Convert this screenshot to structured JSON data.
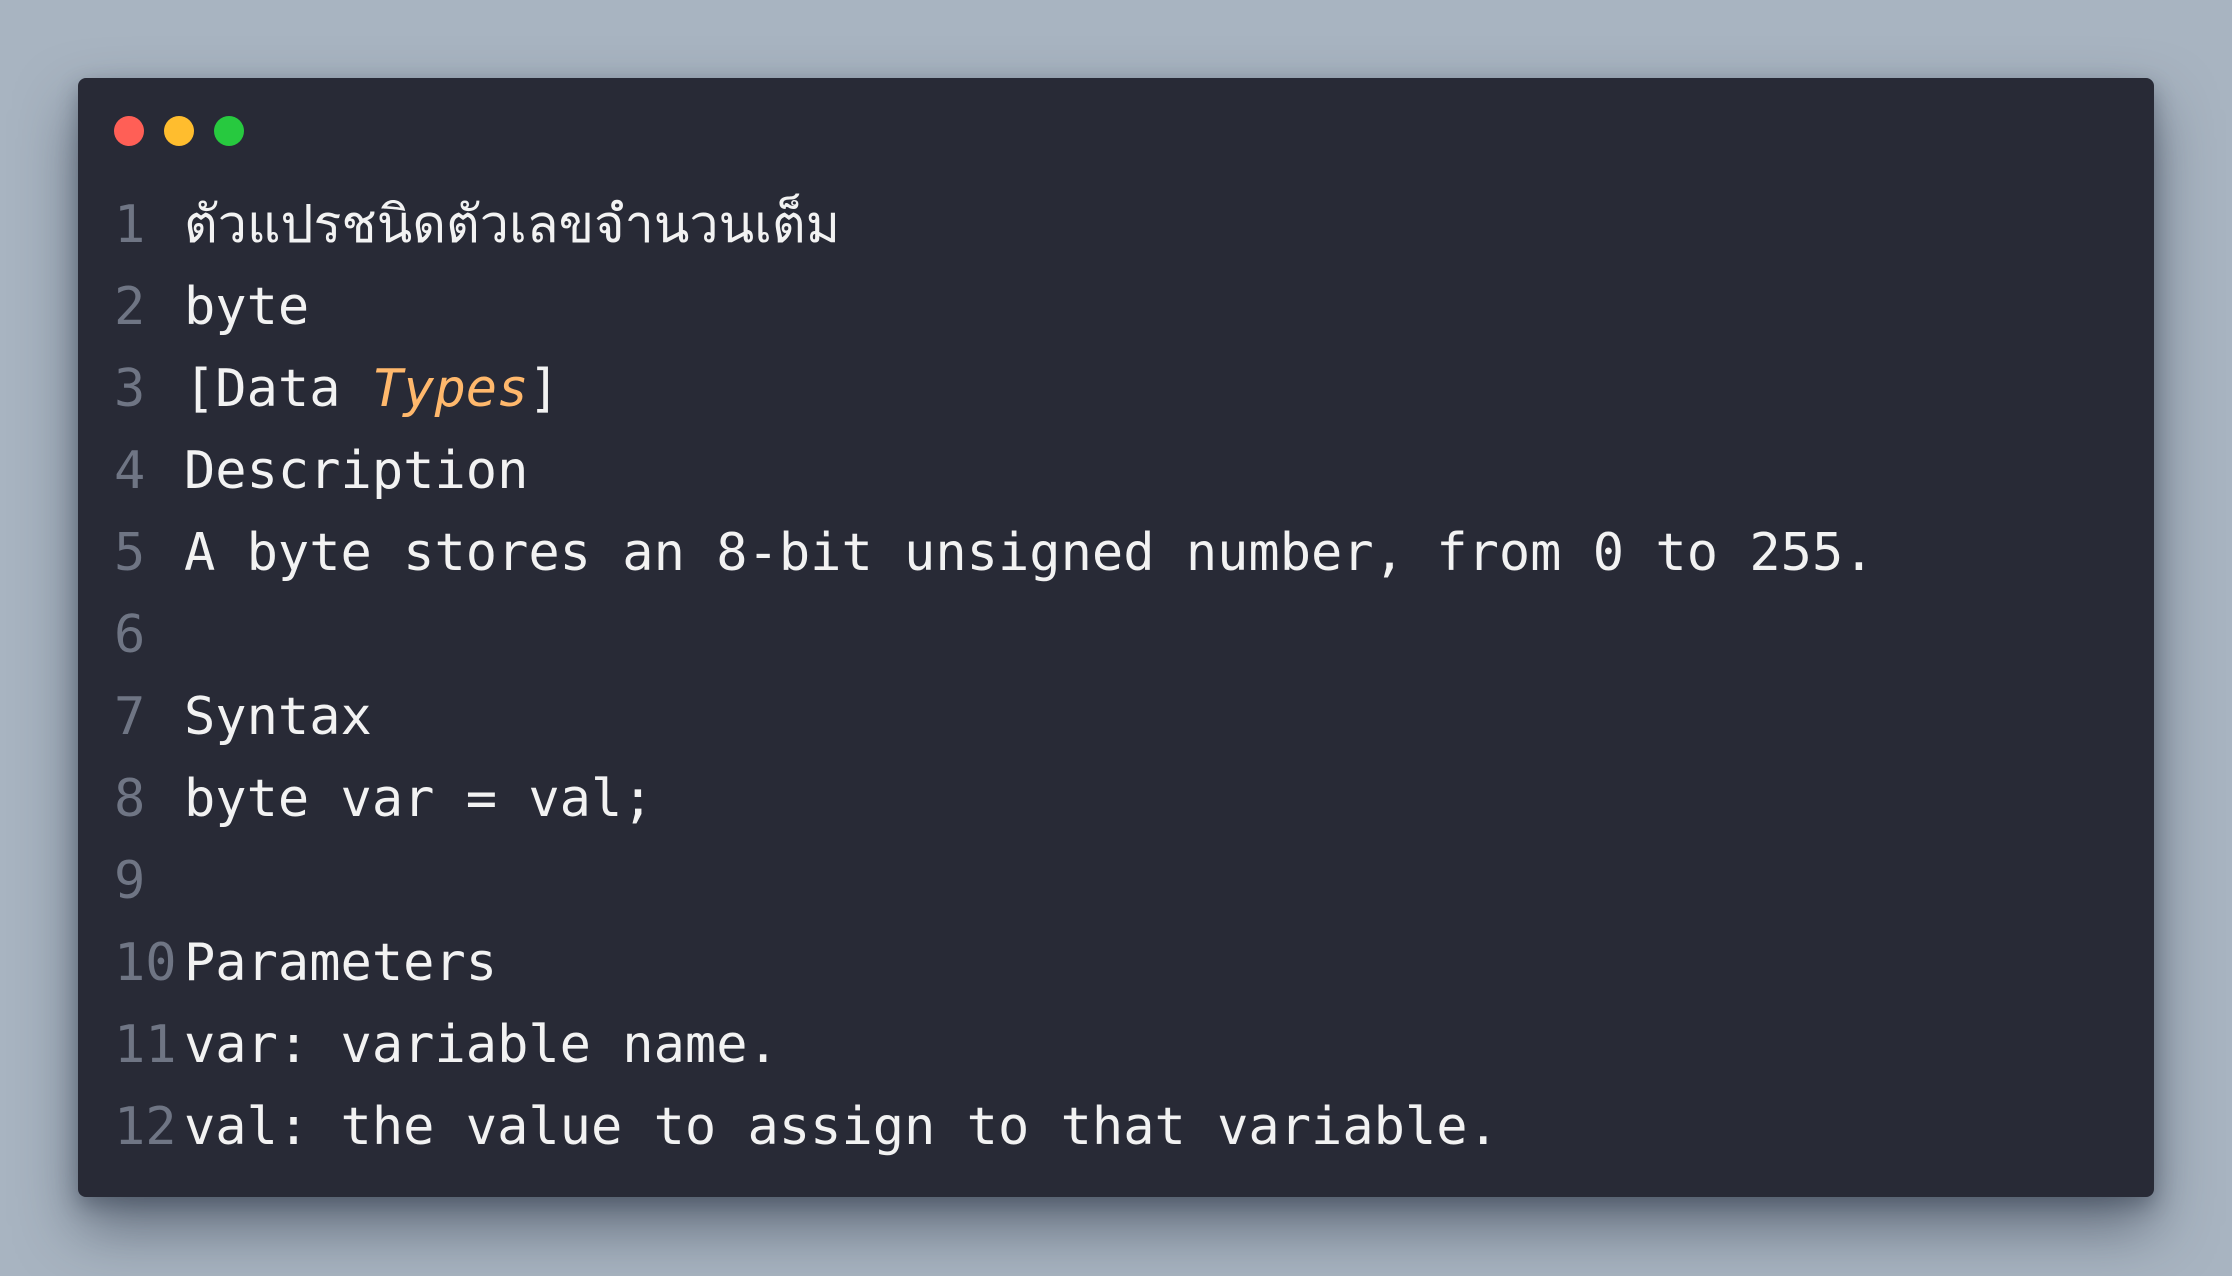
{
  "colors": {
    "background": "#a8b4c1",
    "window": "#282a36",
    "text": "#f2f2f2",
    "line_number": "#6f7584",
    "highlight": "#ffb86c",
    "close_dot": "#ff5f56",
    "minimize_dot": "#ffbd2e",
    "maximize_dot": "#27c93f"
  },
  "lines": [
    {
      "num": "1",
      "text": "ตัวแปรชนิดตัวเลขจำนวนเต็ม"
    },
    {
      "num": "2",
      "text": "byte"
    },
    {
      "num": "3",
      "prefix": "[Data ",
      "highlight": "Types",
      "suffix": "]"
    },
    {
      "num": "4",
      "text": "Description"
    },
    {
      "num": "5",
      "text": "A byte stores an 8-bit unsigned number, from 0 to 255."
    },
    {
      "num": "6",
      "text": ""
    },
    {
      "num": "7",
      "text": "Syntax"
    },
    {
      "num": "8",
      "text": "byte var = val;"
    },
    {
      "num": "9",
      "text": ""
    },
    {
      "num": "10",
      "text": "Parameters"
    },
    {
      "num": "11",
      "text": "var: variable name."
    },
    {
      "num": "12",
      "text": "val: the value to assign to that variable."
    }
  ]
}
